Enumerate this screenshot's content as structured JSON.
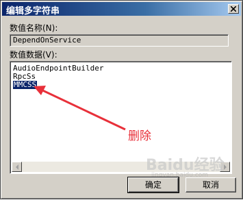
{
  "window": {
    "title": "编辑多字符串"
  },
  "value_name": {
    "label": "数值名称(N):",
    "value": "DependOnService"
  },
  "value_data": {
    "label": "数值数据(V):",
    "lines": [
      "AudioEndpointBuilder",
      "RpcSs",
      "MMCSS"
    ],
    "selected_index": 2
  },
  "buttons": {
    "ok_label": "确定",
    "cancel_label": "取消"
  },
  "annotation": {
    "text": "删除",
    "color": "#e8303a"
  },
  "watermark": {
    "text": "Baidu经验",
    "sub": "jingyan.baidu.com"
  },
  "icons": {
    "close": "close-icon",
    "scroll_left": "arrow-left-icon",
    "scroll_right": "arrow-right-icon"
  }
}
